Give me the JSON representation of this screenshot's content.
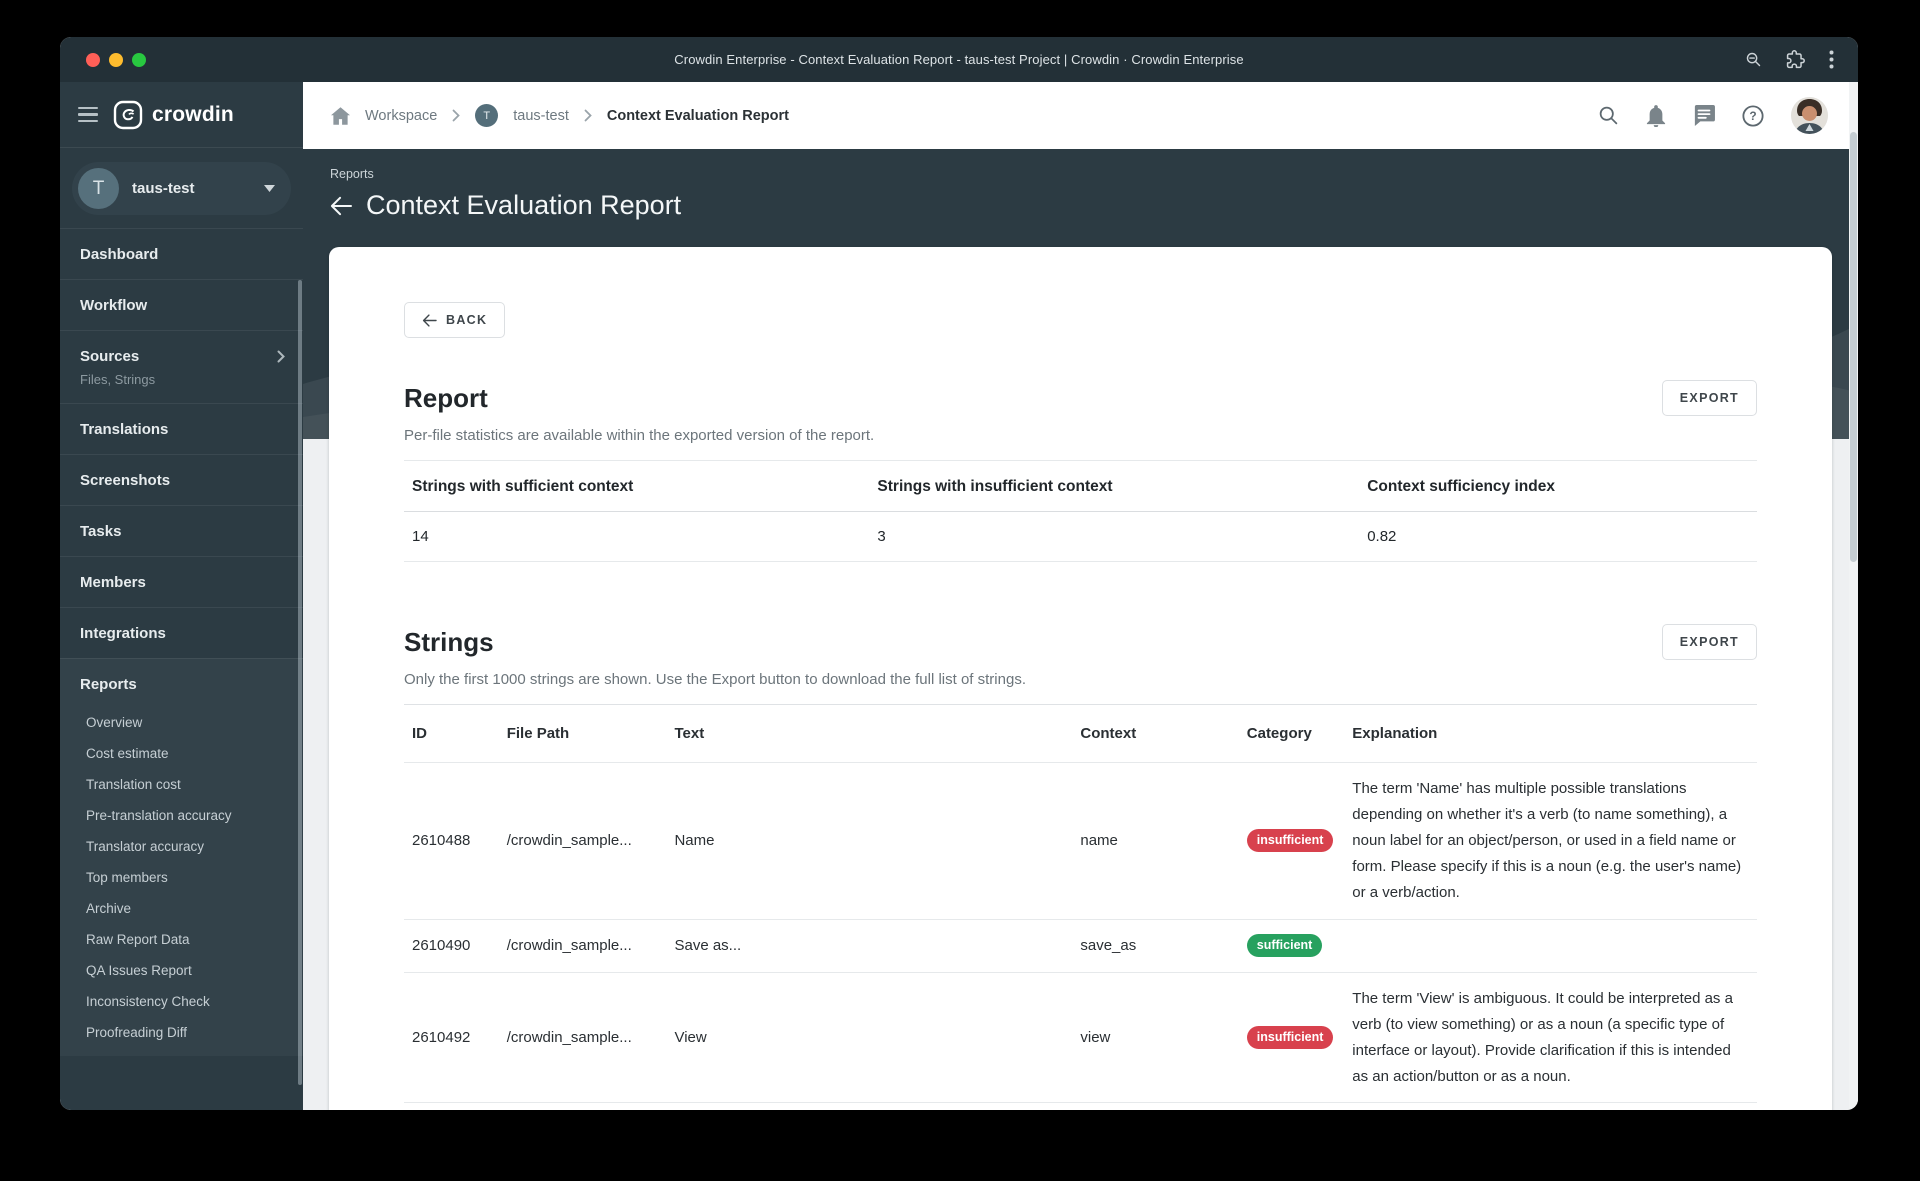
{
  "window": {
    "title": "Crowdin Enterprise - Context Evaluation Report - taus-test Project | Crowdin · Crowdin Enterprise"
  },
  "sidebar": {
    "brand": "crowdin",
    "project": {
      "initial": "T",
      "name": "taus-test"
    },
    "items": [
      {
        "label": "Dashboard"
      },
      {
        "label": "Workflow"
      },
      {
        "label": "Sources",
        "subtitle": "Files, Strings"
      },
      {
        "label": "Translations"
      },
      {
        "label": "Screenshots"
      },
      {
        "label": "Tasks"
      },
      {
        "label": "Members"
      },
      {
        "label": "Integrations"
      },
      {
        "label": "Reports"
      }
    ],
    "report_items": [
      "Overview",
      "Cost estimate",
      "Translation cost",
      "Pre-translation accuracy",
      "Translator accuracy",
      "Top members",
      "Archive",
      "Raw Report Data",
      "QA Issues Report",
      "Inconsistency Check",
      "Proofreading Diff"
    ]
  },
  "breadcrumb": {
    "workspace": "Workspace",
    "project_initial": "T",
    "project": "taus-test",
    "current": "Context Evaluation Report"
  },
  "page_header": {
    "eyebrow": "Reports",
    "title": "Context Evaluation Report"
  },
  "report_section": {
    "back_label": "BACK",
    "title": "Report",
    "export_label": "EXPORT",
    "subtitle": "Per-file statistics are available within the exported version of the report.",
    "stats": {
      "headers": [
        "Strings with sufficient context",
        "Strings with insufficient context",
        "Context sufficiency index"
      ],
      "values": [
        "14",
        "3",
        "0.82"
      ]
    }
  },
  "strings_section": {
    "title": "Strings",
    "export_label": "EXPORT",
    "subtitle": "Only the first 1000 strings are shown. Use the Export button to download the full list of strings.",
    "table": {
      "headers": [
        "ID",
        "File Path",
        "Text",
        "Context",
        "Category",
        "Explanation"
      ],
      "rows": [
        {
          "id": "2610488",
          "file_path": "/crowdin_sample...",
          "text": "Name",
          "context": "name",
          "category": "insufficient",
          "explanation": "The term 'Name' has multiple possible translations depending on whether it's a verb (to name something), a noun label for an object/person, or used in a field name or form. Please specify if this is a noun (e.g. the user's name) or a verb/action."
        },
        {
          "id": "2610490",
          "file_path": "/crowdin_sample...",
          "text": "Save as...",
          "context": "save_as",
          "category": "sufficient",
          "explanation": ""
        },
        {
          "id": "2610492",
          "file_path": "/crowdin_sample...",
          "text": "View",
          "context": "view",
          "category": "insufficient",
          "explanation": "The term 'View' is ambiguous. It could be interpreted as a verb (to view something) or as a noun (a specific type of interface or layout). Provide clarification if this is intended as an action/button or as a noun."
        }
      ]
    }
  },
  "colors": {
    "badge_insufficient": "#d8414d",
    "badge_sufficient": "#27a15f",
    "sidebar_dark": "#2c3b43",
    "titlebar_dark": "#233037"
  }
}
